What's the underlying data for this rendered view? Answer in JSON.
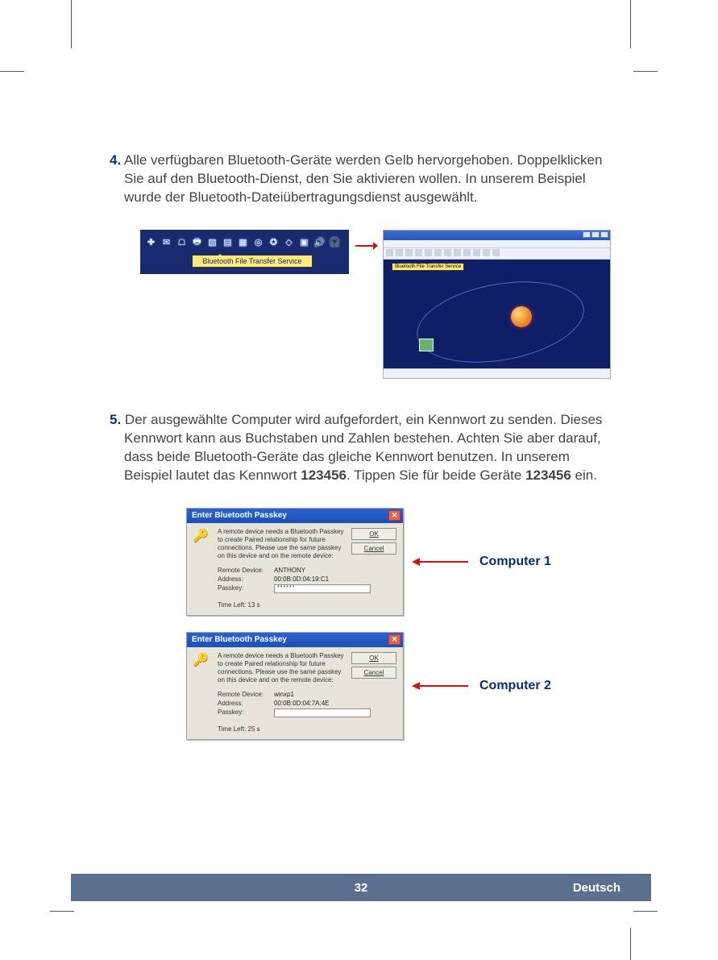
{
  "step4": {
    "num": "4.",
    "text": "Alle verfügbaren Bluetooth-Geräte werden Gelb hervorgehoben. Doppelklicken Sie auf den Bluetooth-Dienst, den Sie aktivieren wollen. In unserem Beispiel wurde der Bluetooth-Dateiübertragungsdienst ausgewählt."
  },
  "toolbar_tooltip": "Bluetooth File Transfer Service",
  "screenshot_tooltip": "Bluetooth File Transfer Service",
  "step5": {
    "num": "5.",
    "text_before_pw1": "Der ausgewählte Computer wird aufgefordert, ein Kennwort zu senden. Dieses Kennwort kann aus Buchstaben und Zahlen bestehen. Achten Sie aber darauf, dass beide Bluetooth-Geräte das gleiche Kennwort benutzen. In unserem Beispiel lautet das Kennwort ",
    "pw1": "123456",
    "text_mid": ". Tippen Sie für beide Geräte ",
    "pw2": "123456",
    "text_after": " ein."
  },
  "dialog_labels": {
    "remote_device": "Remote Device:",
    "address": "Address:",
    "passkey": "Passkey:"
  },
  "dialog_buttons": {
    "ok": "OK",
    "cancel": "Cancel"
  },
  "dialog1": {
    "title": "Enter Bluetooth Passkey",
    "msg": "A remote device needs a Bluetooth Passkey to create Paired relationship for future connections. Please use the same passkey on this device and on the remote device:",
    "remote_device": "ANTHONY",
    "address": "00:0B:0D:04:19:C1",
    "passkey_masked": "******",
    "time_left": "Time Left: 13 s"
  },
  "dialog2": {
    "title": "Enter Bluetooth Passkey",
    "msg": "A remote device needs a Bluetooth Passkey to create Paired relationship for future connections. Please use the same passkey on this device and on the remote device:",
    "remote_device": "winxp1",
    "address": "00:0B:0D:04:7A:4E",
    "passkey_masked": "",
    "time_left": "Time Left: 25 s"
  },
  "computer_labels": {
    "c1": "Computer 1",
    "c2": "Computer 2"
  },
  "footer": {
    "page": "32",
    "lang": "Deutsch"
  }
}
